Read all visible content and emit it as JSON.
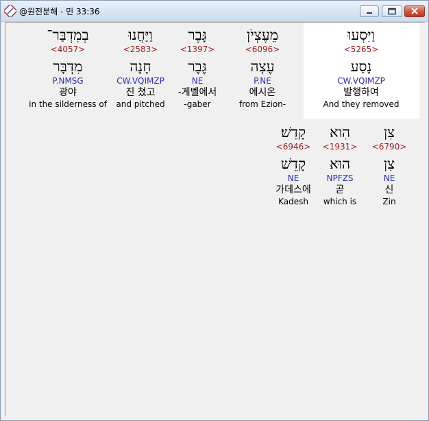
{
  "window": {
    "title": "@원전분해 - 민 33:36",
    "buttons": {
      "minimize": "minimize",
      "maximize": "maximize",
      "close": "close"
    }
  },
  "words": [
    {
      "hebrew": "וַיִּסְעוּ",
      "strong": "<5265>",
      "lemma": "נָסַע",
      "morph": "CW.VQIMZP",
      "korean": "발행하여",
      "english": "And they removed",
      "selected": true
    },
    {
      "hebrew": "מֵעֶצְיֹן",
      "strong": "<6096>",
      "lemma": "עֶצְה",
      "morph": "P.NE",
      "korean": "에시온",
      "english": "from Ezion-"
    },
    {
      "hebrew": "גָּבֶר",
      "strong": "<1397>",
      "lemma": "גֶּבֶר",
      "morph": "NE",
      "korean": "-게벨에서",
      "english": "-gaber"
    },
    {
      "hebrew": "וַיַּחֲנוּ",
      "strong": "<2583>",
      "lemma": "חָנָה",
      "morph": "CW.VQIMZP",
      "korean": "진 쳤고",
      "english": "and pitched"
    },
    {
      "hebrew": "בְמִדְבַּר־",
      "strong": "<4057>",
      "lemma": "מִדְבָּר",
      "morph": "P.NMSG",
      "korean": "광야",
      "english": "in the silderness of"
    },
    {
      "hebrew": "צִן",
      "strong": "<6790>",
      "lemma": "צִן",
      "morph": "NE",
      "korean": "신",
      "english": "Zin"
    },
    {
      "hebrew": "הִוא",
      "strong": "<1931>",
      "lemma": "הוּא",
      "morph": "NPFZS",
      "korean": "곧",
      "english": "which is"
    },
    {
      "hebrew": "קָדֵשׁ׃",
      "strong": "<6946>",
      "lemma": "קָדֵשׁ",
      "morph": "NE",
      "korean": "가데스에",
      "english": "Kadesh"
    }
  ]
}
